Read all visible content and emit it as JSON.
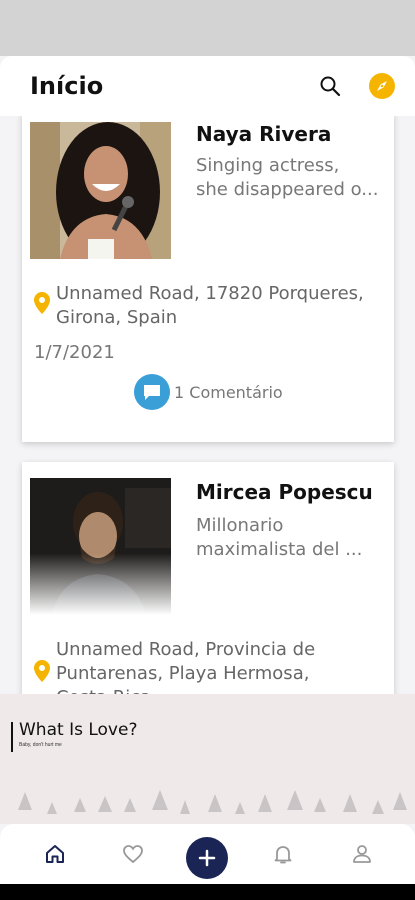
{
  "header": {
    "title": "Início"
  },
  "posts": [
    {
      "name": "Naya Rivera",
      "description": "Singing actress,\nshe disappeared o...",
      "address": "Unnamed Road, 17820 Porqueres,\nGirona, Spain",
      "date": "1/7/2021",
      "comments_label": "1 Comentário"
    },
    {
      "name": "Mircea Popescu",
      "description": "Millonario\nmaximalista del ...",
      "address": "Unnamed Road, Provincia de\nPuntarenas, Playa Hermosa,\nCosta Rica"
    }
  ],
  "banner": {
    "title": "What Is Love?",
    "subtitle": "Baby, don't hurt me"
  },
  "colors": {
    "accent": "#f4b400",
    "fab": "#1b2555",
    "comment": "#3a9fd6"
  }
}
